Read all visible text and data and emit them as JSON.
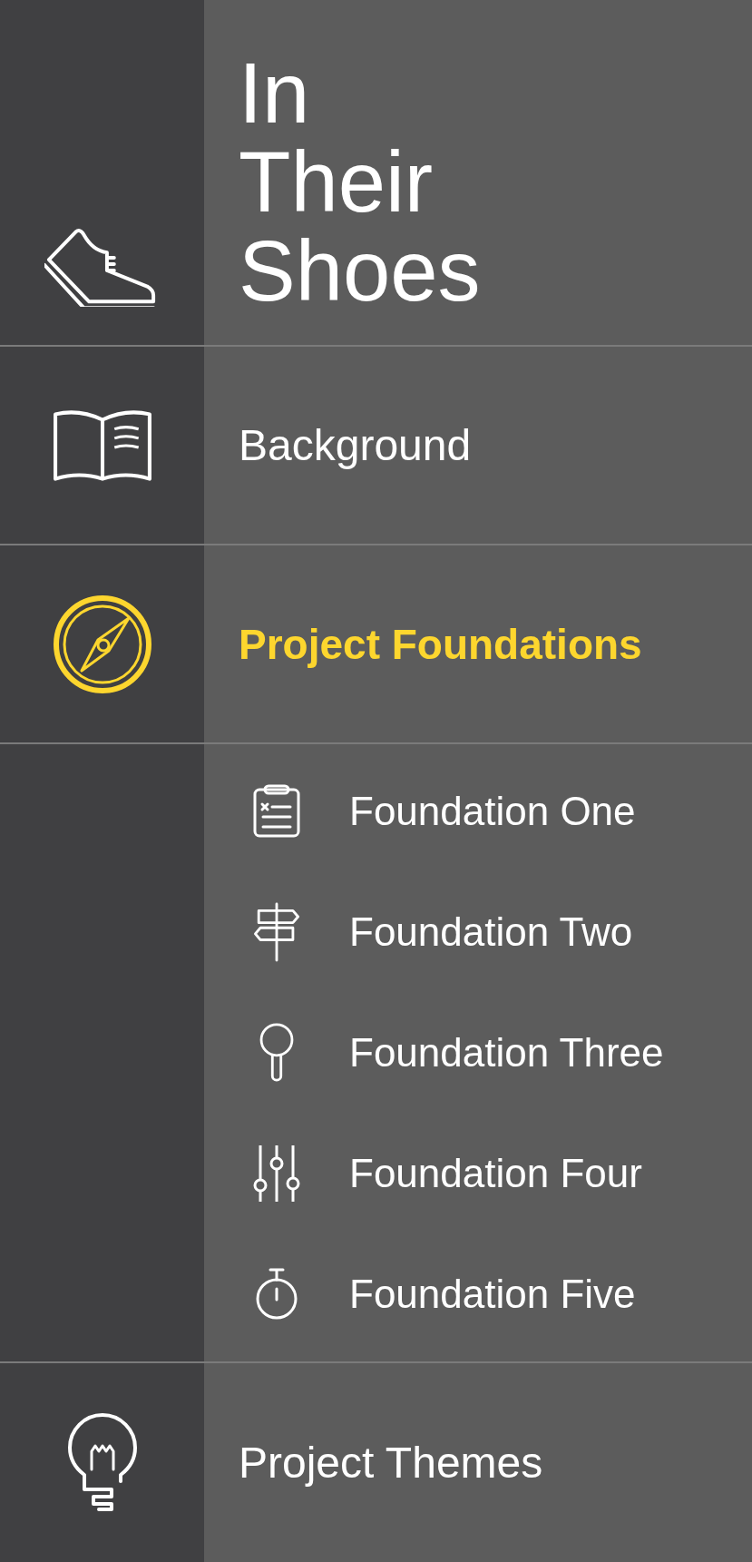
{
  "header": {
    "title_lines": [
      "In",
      "Their",
      "Shoes"
    ]
  },
  "sections": [
    {
      "label": "Background",
      "selected": false
    },
    {
      "label": "Project Foundations",
      "selected": true,
      "expanded": true,
      "children": [
        {
          "label": "Foundation One"
        },
        {
          "label": "Foundation Two"
        },
        {
          "label": "Foundation Three"
        },
        {
          "label": "Foundation Four"
        },
        {
          "label": "Foundation Five"
        }
      ]
    },
    {
      "label": "Project Themes",
      "selected": false
    }
  ]
}
